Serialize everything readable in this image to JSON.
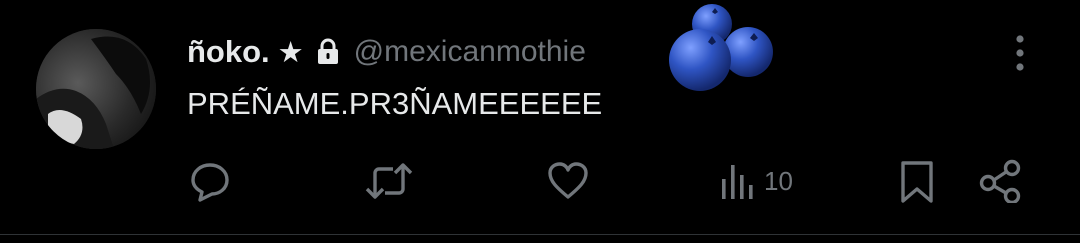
{
  "tweet": {
    "display_name": "ñoko.",
    "badge_star": "★",
    "handle": "@mexicanmothie",
    "text": "PRÉÑAME.PR3ÑAMEEEEEE",
    "views_count": "10"
  },
  "icons": {
    "avatar": "avatar-photo",
    "lock": "lock-icon",
    "emoji": "blueberries-emoji",
    "more": "more-vertical-icon",
    "reply": "reply-icon",
    "retweet": "retweet-icon",
    "like": "heart-icon",
    "views": "views-chart-icon",
    "bookmark": "bookmark-icon",
    "share": "share-icon"
  },
  "colors": {
    "background": "#000000",
    "primary_text": "#e7e9ea",
    "secondary_text": "#71767b",
    "blueberry": "#2f55c4"
  }
}
